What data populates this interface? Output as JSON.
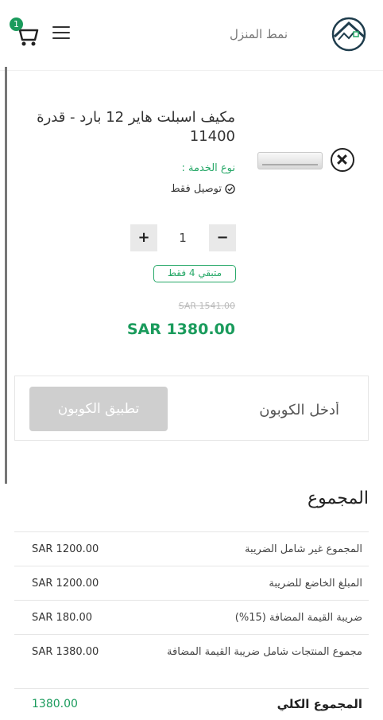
{
  "header": {
    "brand_name": "نمط المنزل",
    "cart_count": "1"
  },
  "product": {
    "name": "مكيف اسبلت هاير 12 بارد - قدرة 11400",
    "service_type_label": "نوع الخدمة :",
    "service_type_value": "توصيل فقط",
    "quantity": "1",
    "minus_label": "−",
    "plus_label": "+",
    "stock_badge": "متبقي 4 فقط",
    "old_price": "SAR 1541.00",
    "price": "SAR 1380.00"
  },
  "coupon": {
    "placeholder": "أدخل الكوبون",
    "apply_label": "تطبيق الكوبون"
  },
  "totals": {
    "title": "المجموع",
    "rows": [
      {
        "label": "المجموع غير شامل الضريبة",
        "value": "SAR 1200.00"
      },
      {
        "label": "المبلغ الخاضع للضريبة",
        "value": "SAR 1200.00"
      },
      {
        "label": "ضريبة القيمة المضافة (15%)",
        "value": "SAR 180.00"
      },
      {
        "label": "مجموع المنتجات شامل ضريبة القيمة المضافة",
        "value": "SAR 1380.00"
      },
      {
        "label": "المجموع الكلي",
        "value": "1380.00"
      }
    ]
  },
  "colors": {
    "accent": "#1a9b5c",
    "badge": "#27a868",
    "button_disabled": "#cfcfcf"
  }
}
